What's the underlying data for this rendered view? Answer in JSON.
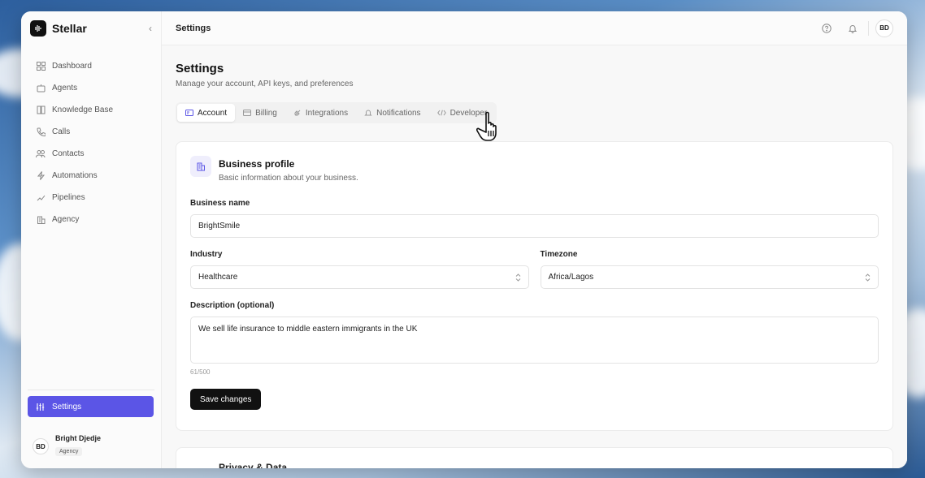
{
  "app": {
    "name": "Stellar"
  },
  "sidebar": {
    "items": [
      {
        "label": "Dashboard",
        "icon": "grid-icon"
      },
      {
        "label": "Agents",
        "icon": "agent-icon"
      },
      {
        "label": "Knowledge Base",
        "icon": "book-icon"
      },
      {
        "label": "Calls",
        "icon": "phone-icon"
      },
      {
        "label": "Contacts",
        "icon": "users-icon"
      },
      {
        "label": "Automations",
        "icon": "bolt-icon"
      },
      {
        "label": "Pipelines",
        "icon": "pipeline-icon"
      },
      {
        "label": "Agency",
        "icon": "building-icon"
      }
    ],
    "settings_label": "Settings",
    "user": {
      "initials": "BD",
      "name": "Bright Djedje",
      "role": "Agency"
    }
  },
  "topbar": {
    "title": "Settings",
    "avatar_initials": "BD"
  },
  "page": {
    "title": "Settings",
    "subtitle": "Manage your account, API keys, and preferences"
  },
  "tabs": [
    {
      "label": "Account",
      "active": true
    },
    {
      "label": "Billing",
      "active": false
    },
    {
      "label": "Integrations",
      "active": false
    },
    {
      "label": "Notifications",
      "active": false
    },
    {
      "label": "Developer",
      "active": false
    }
  ],
  "business_profile": {
    "title": "Business profile",
    "description": "Basic information about your business.",
    "business_name_label": "Business name",
    "business_name_value": "BrightSmile",
    "industry_label": "Industry",
    "industry_value": "Healthcare",
    "timezone_label": "Timezone",
    "timezone_value": "Africa/Lagos",
    "description_label": "Description (optional)",
    "description_value": "We sell life insurance to middle eastern immigrants in the UK",
    "counter": "61/500",
    "save_label": "Save changes"
  },
  "privacy_card": {
    "title": "Privacy & Data"
  },
  "colors": {
    "accent": "#5b55e6",
    "primary_button": "#111111"
  }
}
